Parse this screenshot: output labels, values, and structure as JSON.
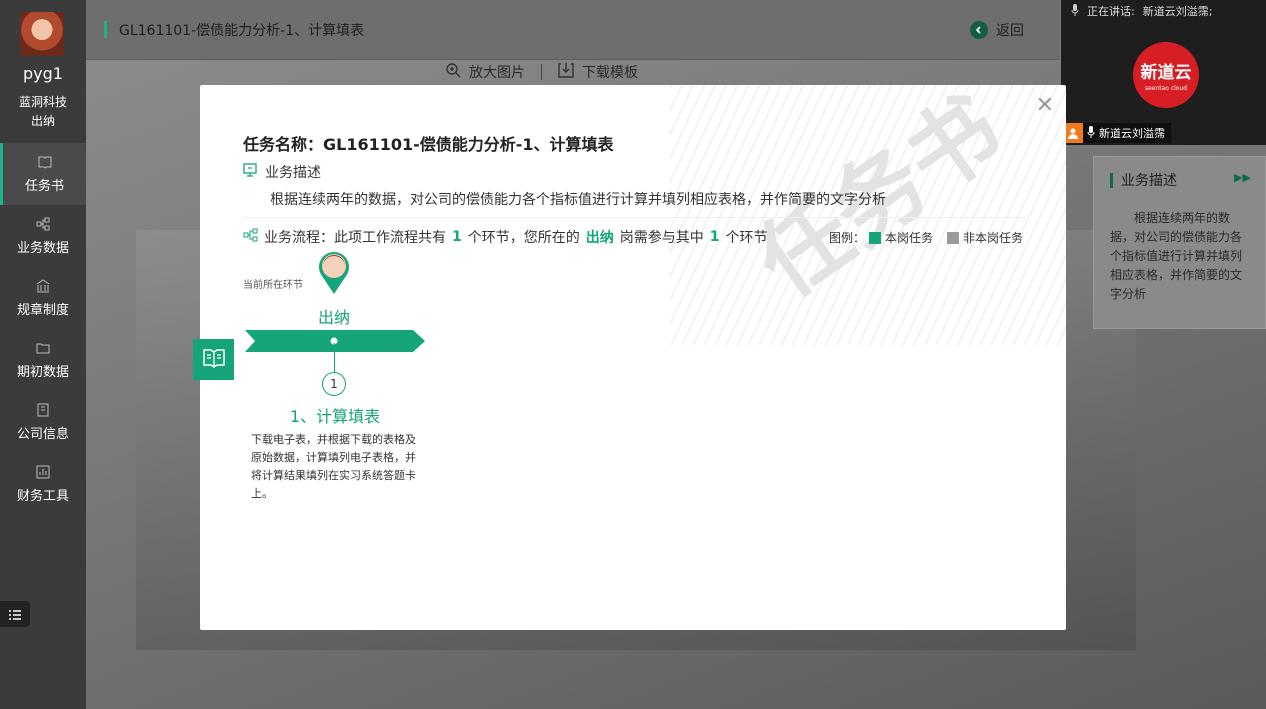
{
  "user": {
    "name": "pyg1",
    "company": "蓝洞科技",
    "role": "出纳"
  },
  "nav": [
    {
      "label": "任务书",
      "icon": "book-icon"
    },
    {
      "label": "业务数据",
      "icon": "flow-icon"
    },
    {
      "label": "规章制度",
      "icon": "bank-icon"
    },
    {
      "label": "期初数据",
      "icon": "folder-icon"
    },
    {
      "label": "公司信息",
      "icon": "building-icon"
    },
    {
      "label": "财务工具",
      "icon": "chart-icon"
    }
  ],
  "topbar": {
    "title": "GL161101-偿债能力分析-1、计算填表",
    "back_label": "返回"
  },
  "tools": {
    "zoom_label": "放大图片",
    "download_label": "下载模板"
  },
  "video": {
    "speaking_label": "正在讲话:",
    "speaking_name": "新道云刘溢霈;",
    "logo_text": "新道云",
    "logo_sub": "seentao cloud",
    "user_tag": "新道云刘溢霈"
  },
  "desc_panel": {
    "title": "业务描述",
    "text": "根据连续两年的数据，对公司的偿债能力各个指标值进行计算并填列相应表格，并作简要的文字分析"
  },
  "modal": {
    "task_name": "任务名称：GL161101-偿债能力分析-1、计算填表",
    "desc_title": "业务描述",
    "desc_text": "根据连续两年的数据，对公司的偿债能力各个指标值进行计算并填列相应表格，并作简要的文字分析",
    "flow": {
      "prefix": "业务流程：此项工作流程共有",
      "total": "1",
      "mid1": "个环节，您所在的",
      "role": "出纳",
      "mid2": "岗需参与其中",
      "count": "1",
      "suffix": "个环节"
    },
    "legend": {
      "label": "图例：",
      "own": "本岗任务",
      "other": "非本岗任务",
      "own_color": "#16a57b",
      "other_color": "#9a9a9a"
    },
    "current_label": "当前所在环节",
    "role_label": "出纳",
    "step": {
      "number": "1",
      "title": "1、计算填表",
      "desc": "下载电子表，并根据下载的表格及原始数据，计算填列电子表格，并将计算结果填列在实习系统答题卡上。"
    }
  }
}
